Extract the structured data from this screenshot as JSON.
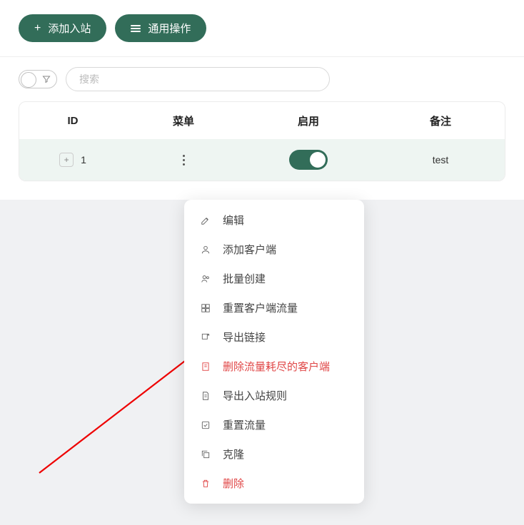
{
  "toolbar": {
    "add_inbound": "添加入站",
    "general_ops": "通用操作"
  },
  "search": {
    "placeholder": "搜索"
  },
  "table": {
    "headers": {
      "id": "ID",
      "menu": "菜单",
      "enable": "启用",
      "remark": "备注"
    },
    "rows": [
      {
        "id": "1",
        "enabled": true,
        "remark": "test"
      }
    ]
  },
  "menu": {
    "edit": "编辑",
    "add_client": "添加客户端",
    "bulk_create": "批量创建",
    "reset_client_traffic": "重置客户端流量",
    "export_links": "导出链接",
    "delete_depleted": "删除流量耗尽的客户端",
    "export_rules": "导出入站规则",
    "reset_traffic": "重置流量",
    "clone": "克隆",
    "delete": "删除"
  }
}
